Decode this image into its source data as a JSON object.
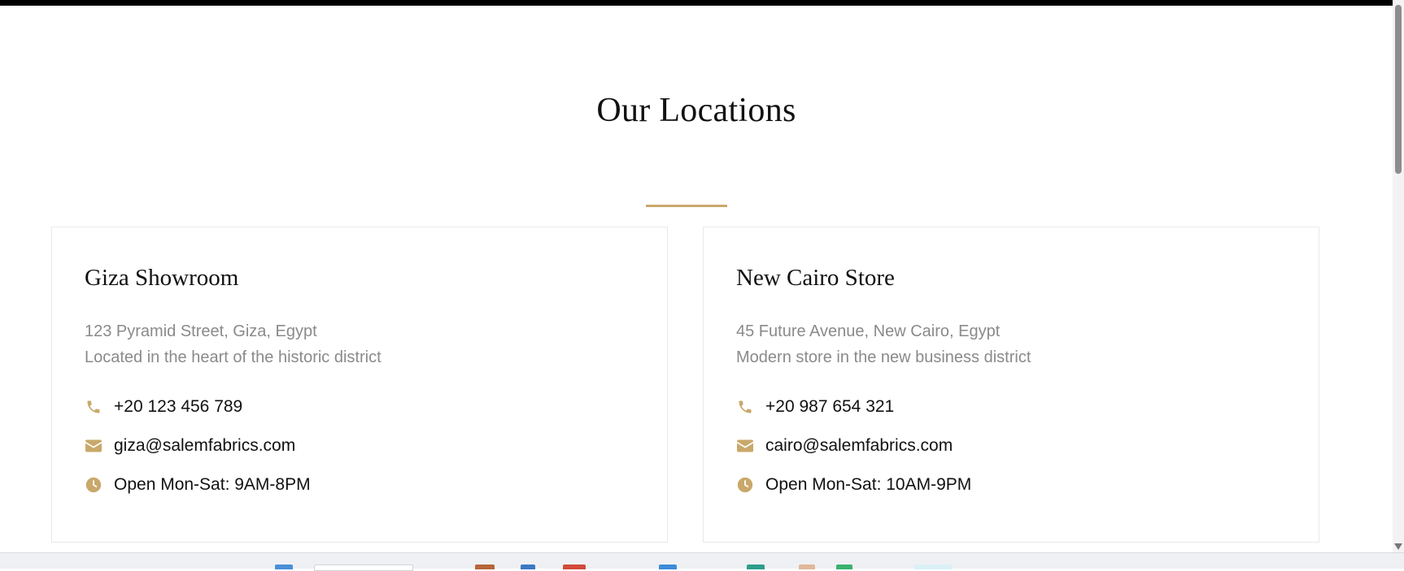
{
  "section": {
    "title": "Our Locations"
  },
  "locations": [
    {
      "name": "Giza Showroom",
      "address": "123 Pyramid Street, Giza, Egypt",
      "description": "Located in the heart of the historic district",
      "phone": "+20 123 456 789",
      "email": "giza@salemfabrics.com",
      "hours": "Open Mon-Sat: 9AM-8PM"
    },
    {
      "name": "New Cairo Store",
      "address": "45 Future Avenue, New Cairo, Egypt",
      "description": "Modern store in the new business district",
      "phone": "+20 987 654 321",
      "email": "cairo@salemfabrics.com",
      "hours": "Open Mon-Sat: 10AM-9PM"
    }
  ],
  "icons": {
    "phone": "phone-icon",
    "email": "envelope-icon",
    "hours": "clock-icon"
  },
  "colors": {
    "accent": "#c9a86a",
    "muted_text": "#8a8a8a"
  }
}
